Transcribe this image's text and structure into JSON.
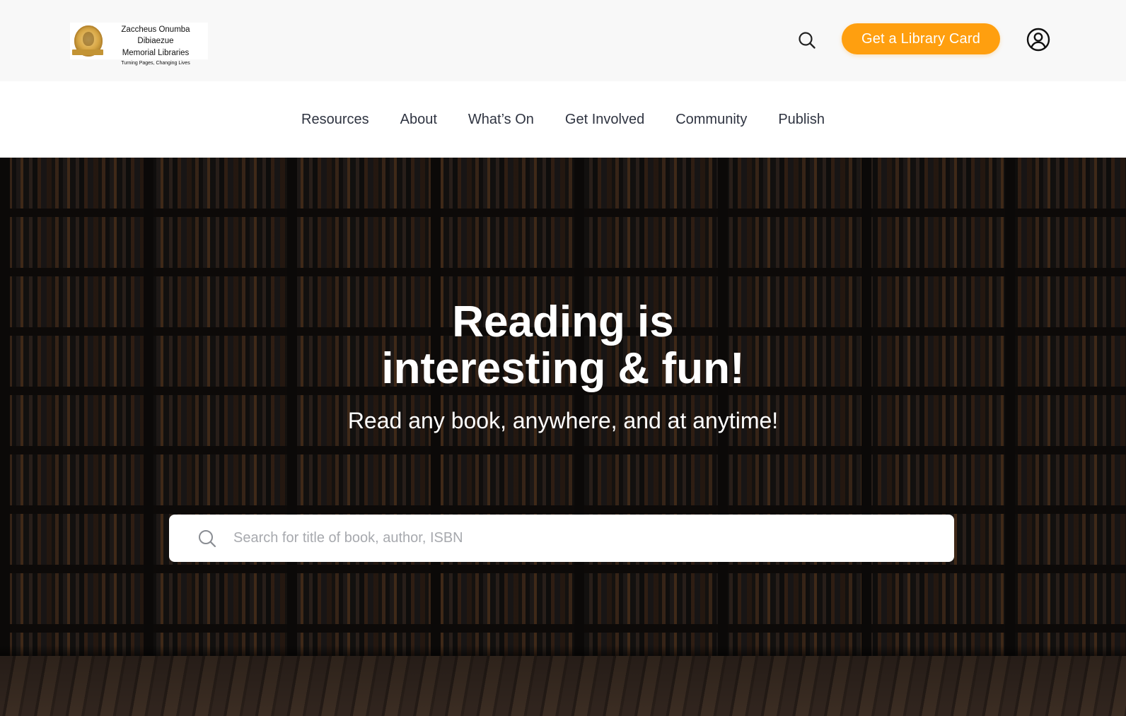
{
  "header": {
    "logo": {
      "line1": "Zaccheus Onumba Dibiaezue",
      "line2": "Memorial Libraries",
      "line3": "Turning Pages, Changing Lives"
    },
    "search_icon": "search-icon",
    "library_card_label": "Get a Library Card",
    "account_icon": "user-circle-icon",
    "accent_color": "#ff9f0f"
  },
  "nav": {
    "items": [
      {
        "label": "Resources"
      },
      {
        "label": "About"
      },
      {
        "label": "What’s On"
      },
      {
        "label": "Get Involved"
      },
      {
        "label": "Community"
      },
      {
        "label": "Publish"
      }
    ]
  },
  "hero": {
    "title_line1": "Reading is",
    "title_line2": "interesting & fun!",
    "subtitle": "Read any book, anywhere, and at anytime!",
    "search": {
      "placeholder": "Search for title of book, author, ISBN",
      "value": ""
    }
  }
}
